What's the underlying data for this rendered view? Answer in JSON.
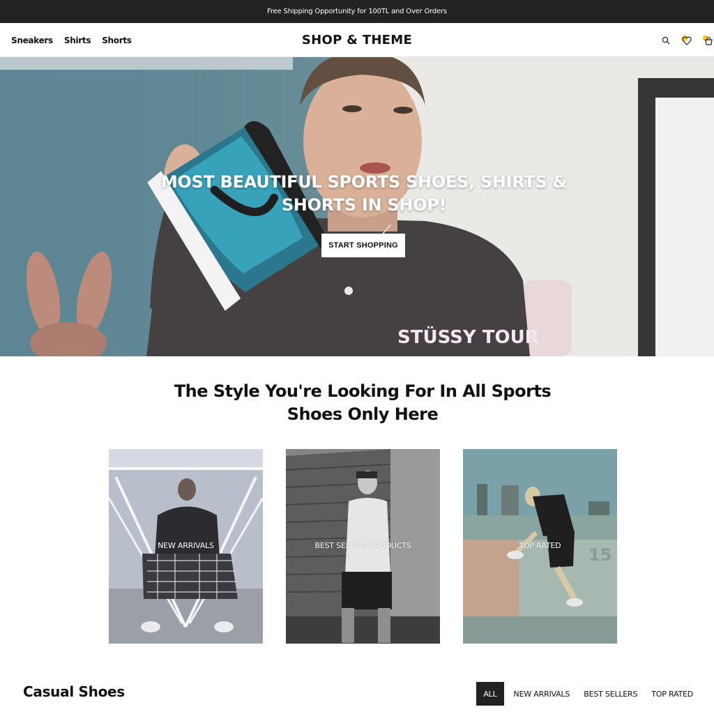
{
  "announcement": "Free Shipping Opportunity for 100TL and Over Orders",
  "header": {
    "nav": [
      "Sneakers",
      "Shirts",
      "Shorts"
    ],
    "brand": "SHOP & THEME",
    "icons": [
      "search-icon",
      "heart-icon",
      "cart-icon"
    ]
  },
  "hero": {
    "title_line1": "MOST BEAUTIFUL SPORTS SHOES, SHIRTS &",
    "title_line2": "SHORTS IN SHOP!",
    "cta": "START SHOPPING",
    "shirt_print": "STÜSSY TOUR"
  },
  "section": {
    "heading_line1": "The Style You're Looking For In All Sports",
    "heading_line2": "Shoes Only Here"
  },
  "categories": [
    {
      "label": "NEW ARRIVALS"
    },
    {
      "label": "BEST SELLING PRODUCTS"
    },
    {
      "label": "TOP RATED"
    }
  ],
  "casual": {
    "title": "Casual Shoes",
    "filters": [
      "ALL",
      "NEW ARRIVALS",
      "BEST SELLERS",
      "TOP RATED"
    ],
    "active_filter": "ALL"
  },
  "colors": {
    "topbar": "#222222",
    "accent_badge": "#f2c200",
    "text": "#111111"
  }
}
